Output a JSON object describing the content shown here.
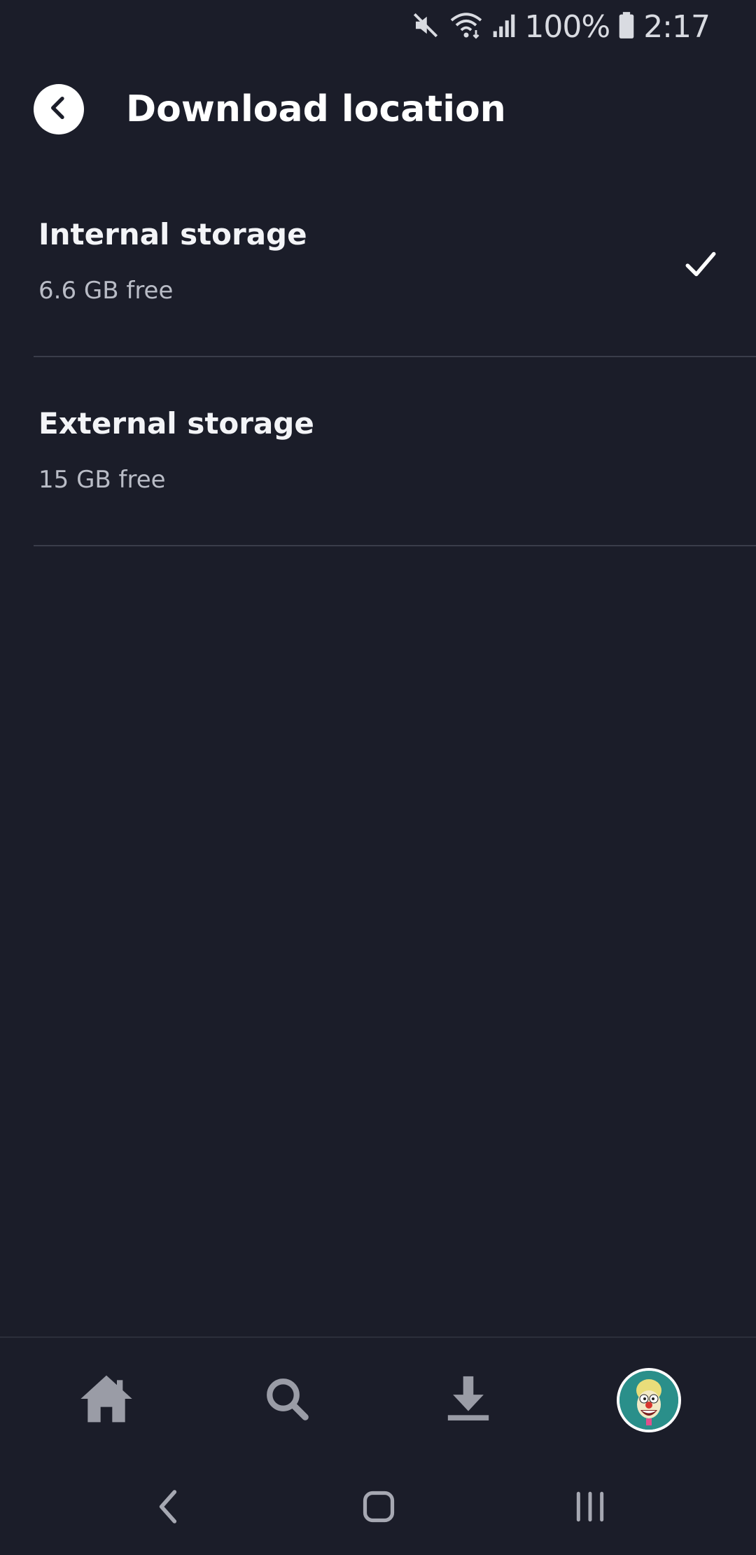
{
  "status_bar": {
    "battery_percent": "100%",
    "time": "2:17",
    "icons": [
      "mute-icon",
      "wifi-icon",
      "signal-icon",
      "battery-icon"
    ]
  },
  "header": {
    "title": "Download location",
    "back_icon": "back-arrow-icon"
  },
  "options": [
    {
      "title": "Internal storage",
      "subtitle": "6.6 GB free",
      "selected": true
    },
    {
      "title": "External storage",
      "subtitle": "15 GB free",
      "selected": false
    }
  ],
  "bottom_nav": {
    "items": [
      {
        "icon": "home-icon"
      },
      {
        "icon": "search-icon"
      },
      {
        "icon": "download-icon"
      },
      {
        "icon": "profile-avatar"
      }
    ]
  },
  "system_nav": {
    "items": [
      "back-icon",
      "home-icon",
      "recents-icon"
    ]
  },
  "colors": {
    "background": "#1b1d29",
    "divider": "#3a3d4a",
    "text_primary": "#ffffff",
    "text_secondary": "#b9bcc6",
    "nav_icon": "#9a9ca6"
  }
}
